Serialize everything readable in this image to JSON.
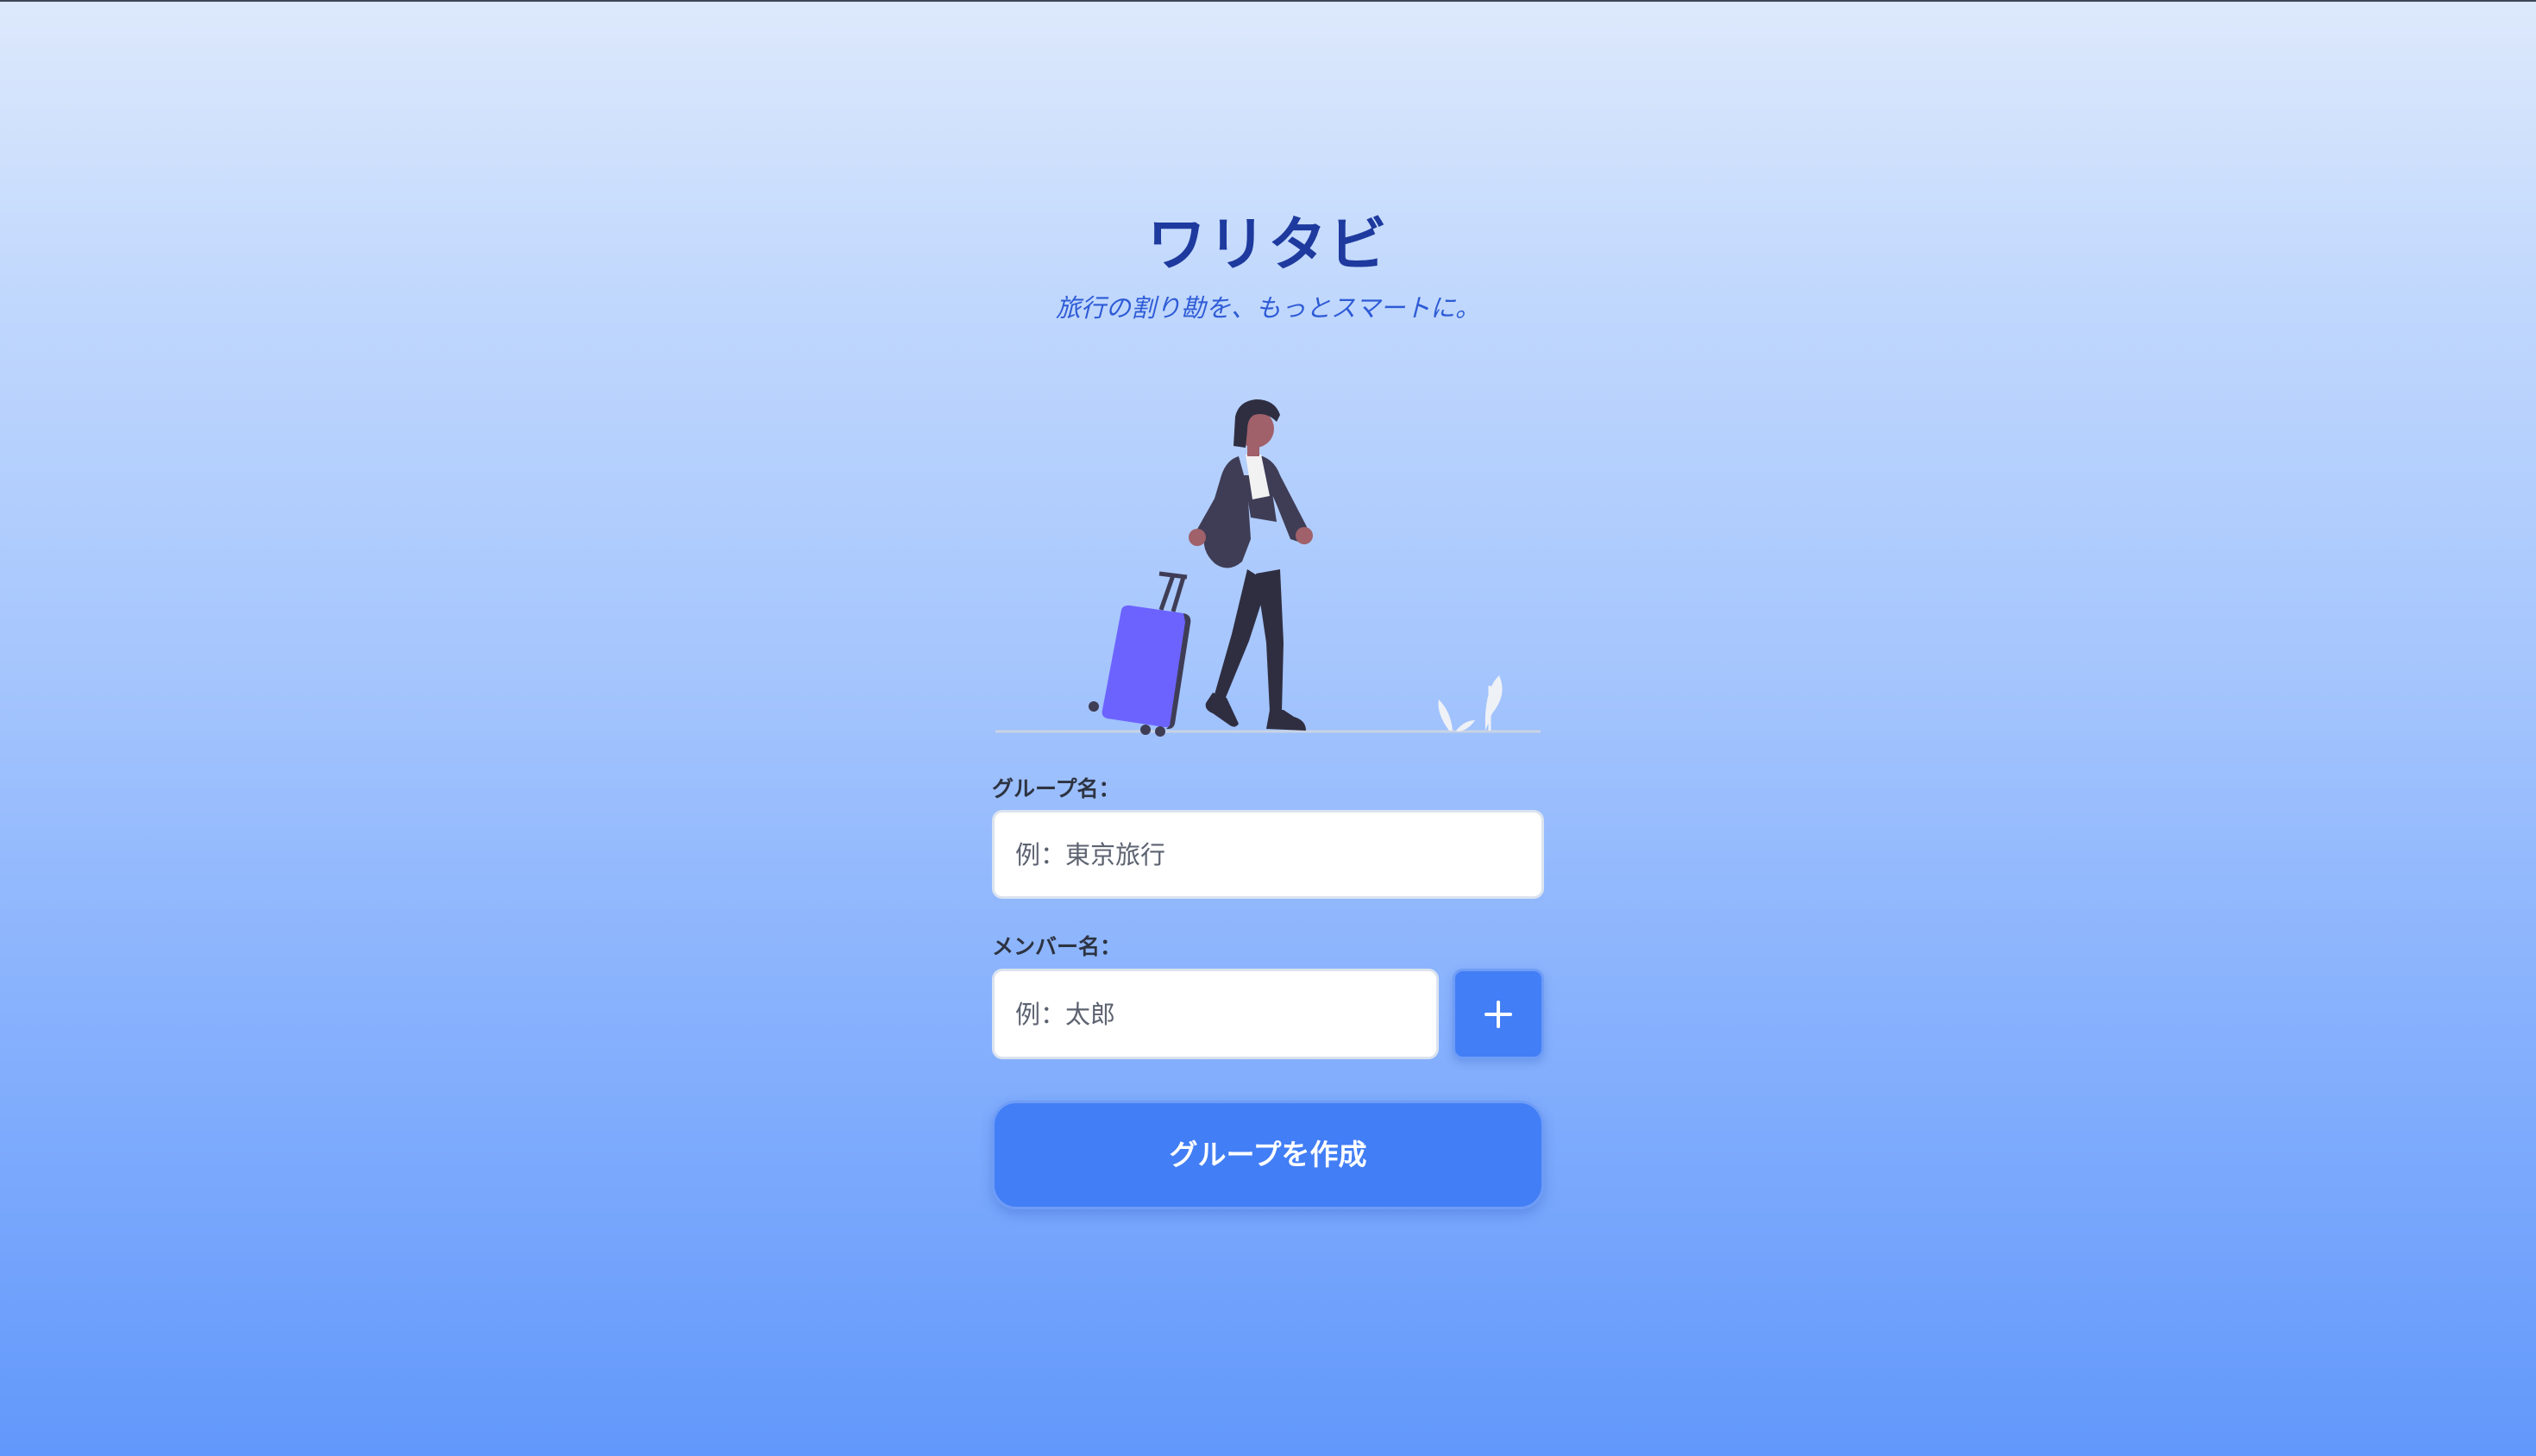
{
  "app": {
    "title": "ワリタビ",
    "tagline": "旅行の割り勘を、もっとスマートに。"
  },
  "form": {
    "group_name": {
      "label": "グループ名：",
      "placeholder": "例：東京旅行",
      "value": ""
    },
    "member_name": {
      "label": "メンバー名：",
      "placeholder": "例：太郎",
      "value": ""
    },
    "add_member_icon": "plus-icon",
    "submit_label": "グループを作成"
  },
  "colors": {
    "title": "#1e3a9e",
    "tagline": "#2e5bd6",
    "accent": "#427ef5",
    "suitcase": "#6c63ff",
    "background_top": "#dde9fc",
    "background_bottom": "#6298fb"
  }
}
